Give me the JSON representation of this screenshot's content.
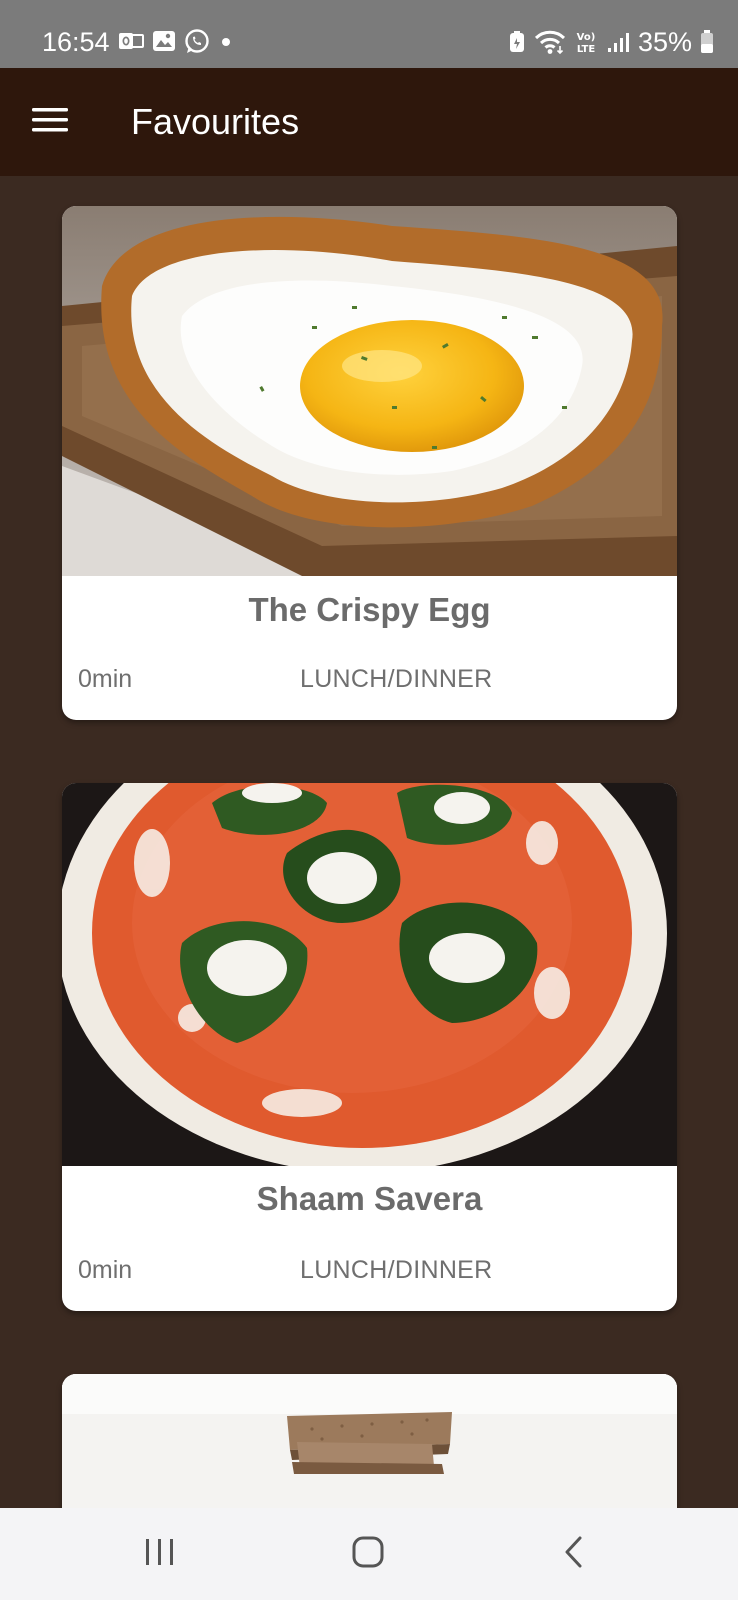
{
  "status_bar": {
    "time": "16:54",
    "battery": "35%",
    "left_icons": [
      "outlook-icon",
      "gallery-icon",
      "whatsapp-icon",
      "dot-icon"
    ],
    "right_icons": [
      "battery-saver-icon",
      "wifi-icon",
      "volte-icon",
      "signal-icon",
      "battery-icon"
    ]
  },
  "app_bar": {
    "title": "Favourites"
  },
  "recipes": [
    {
      "title": "The Crispy Egg",
      "time": "0min",
      "category": "LUNCH/DINNER",
      "image": "fried-egg-on-toast"
    },
    {
      "title": "Shaam Savera",
      "time": "0min",
      "category": "LUNCH/DINNER",
      "image": "spinach-kofta-in-tomato-gravy"
    },
    {
      "title": "",
      "time": "",
      "category": "",
      "image": "stacked-crackers"
    }
  ],
  "nav_bar": {
    "buttons": [
      "recent-apps-button",
      "home-button",
      "back-button"
    ]
  },
  "colors": {
    "status_bar": "#7b7b7b",
    "app_bar": "#2e170c",
    "background": "#3b2a21",
    "card": "#ffffff",
    "text_gray": "#6b6b6b",
    "nav_bar": "#f4f4f6"
  }
}
